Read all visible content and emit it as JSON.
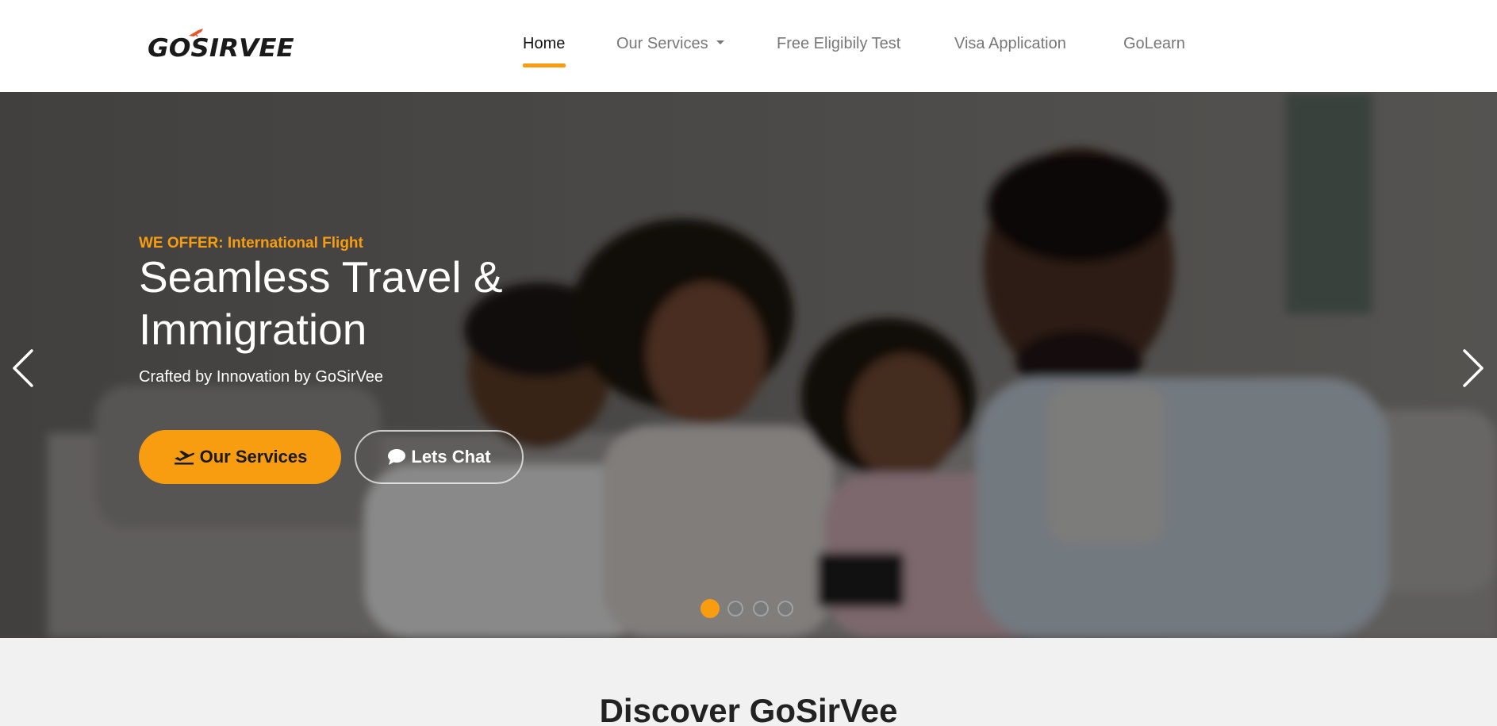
{
  "brand": {
    "logo_text": "GOSIRVEE",
    "accent_color": "#f99d10"
  },
  "nav": {
    "items": [
      {
        "label": "Home",
        "active": true
      },
      {
        "label": "Our Services",
        "dropdown": true
      },
      {
        "label": "Free Eligibily Test"
      },
      {
        "label": "Visa Application"
      },
      {
        "label": "GoLearn"
      }
    ]
  },
  "hero": {
    "offer": "WE OFFER: International Flight",
    "headline": "Seamless Travel & Immigration",
    "subline": "Crafted by Innovation by GoSirVee",
    "primary_button": {
      "label": "Our Services",
      "icon": "plane-departure-icon"
    },
    "secondary_button": {
      "label": "Lets Chat",
      "icon": "chat-bubble-icon"
    },
    "slides_count": 4,
    "active_slide": 1
  },
  "discover": {
    "title": "Discover GoSirVee"
  }
}
